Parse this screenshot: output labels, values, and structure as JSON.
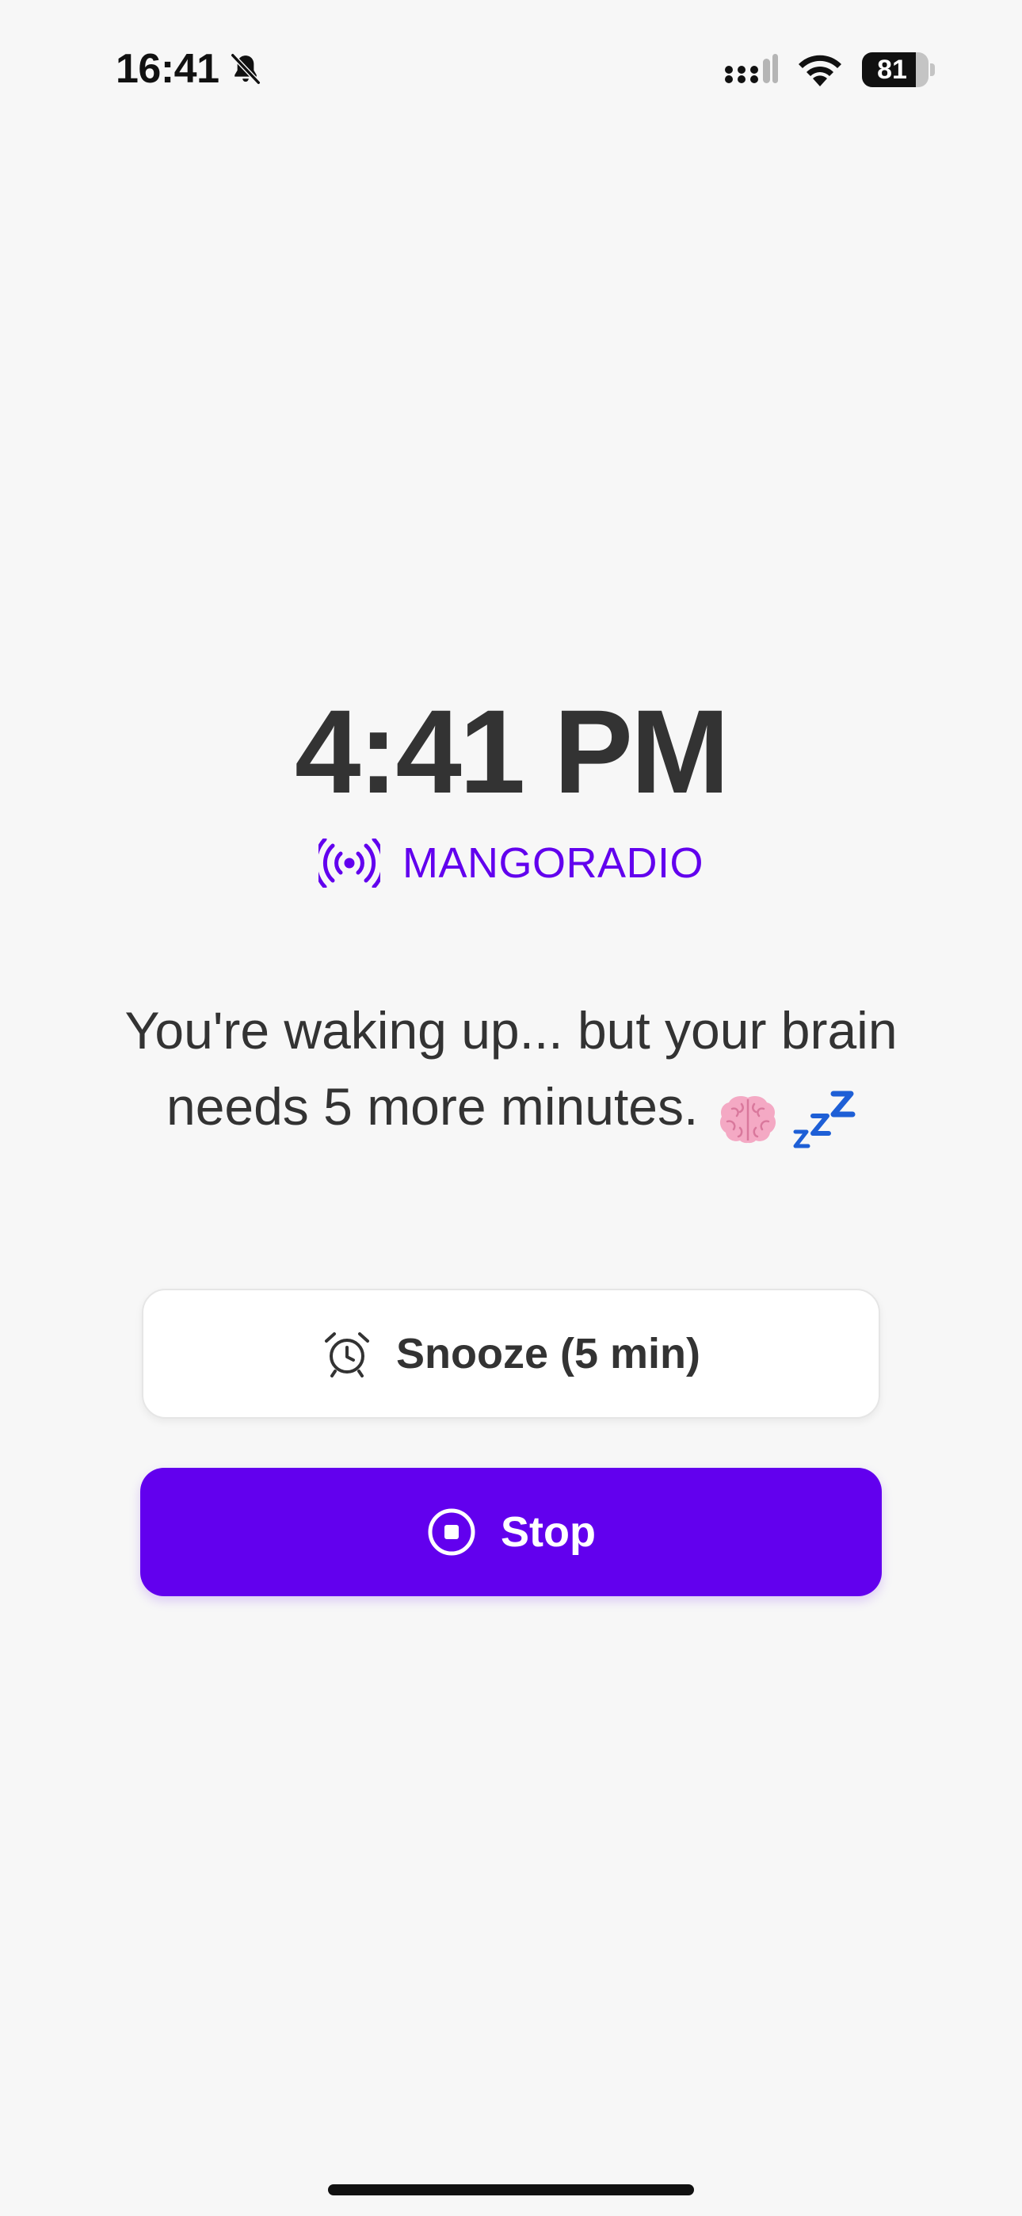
{
  "status_bar": {
    "time": "16:41",
    "silent_icon": "bell-slash-icon",
    "signal_icon": "cellular-signal-icon",
    "wifi_icon": "wifi-icon",
    "battery_level": "81",
    "battery_fraction": 0.81
  },
  "alarm": {
    "time": "4:41 PM",
    "station_icon": "broadcast-radio-icon",
    "station": "MANGORADIO",
    "message": "You're waking up... but your brain needs 5 more minutes.",
    "emoji": [
      "brain-emoji",
      "zzz-emoji"
    ]
  },
  "actions": {
    "snooze_label": "Snooze (5 min)",
    "snooze_icon": "alarm-clock-icon",
    "stop_label": "Stop",
    "stop_icon": "stop-circle-icon"
  },
  "colors": {
    "accent": "#6200ee",
    "background": "#f7f7f7",
    "text": "#333333"
  }
}
